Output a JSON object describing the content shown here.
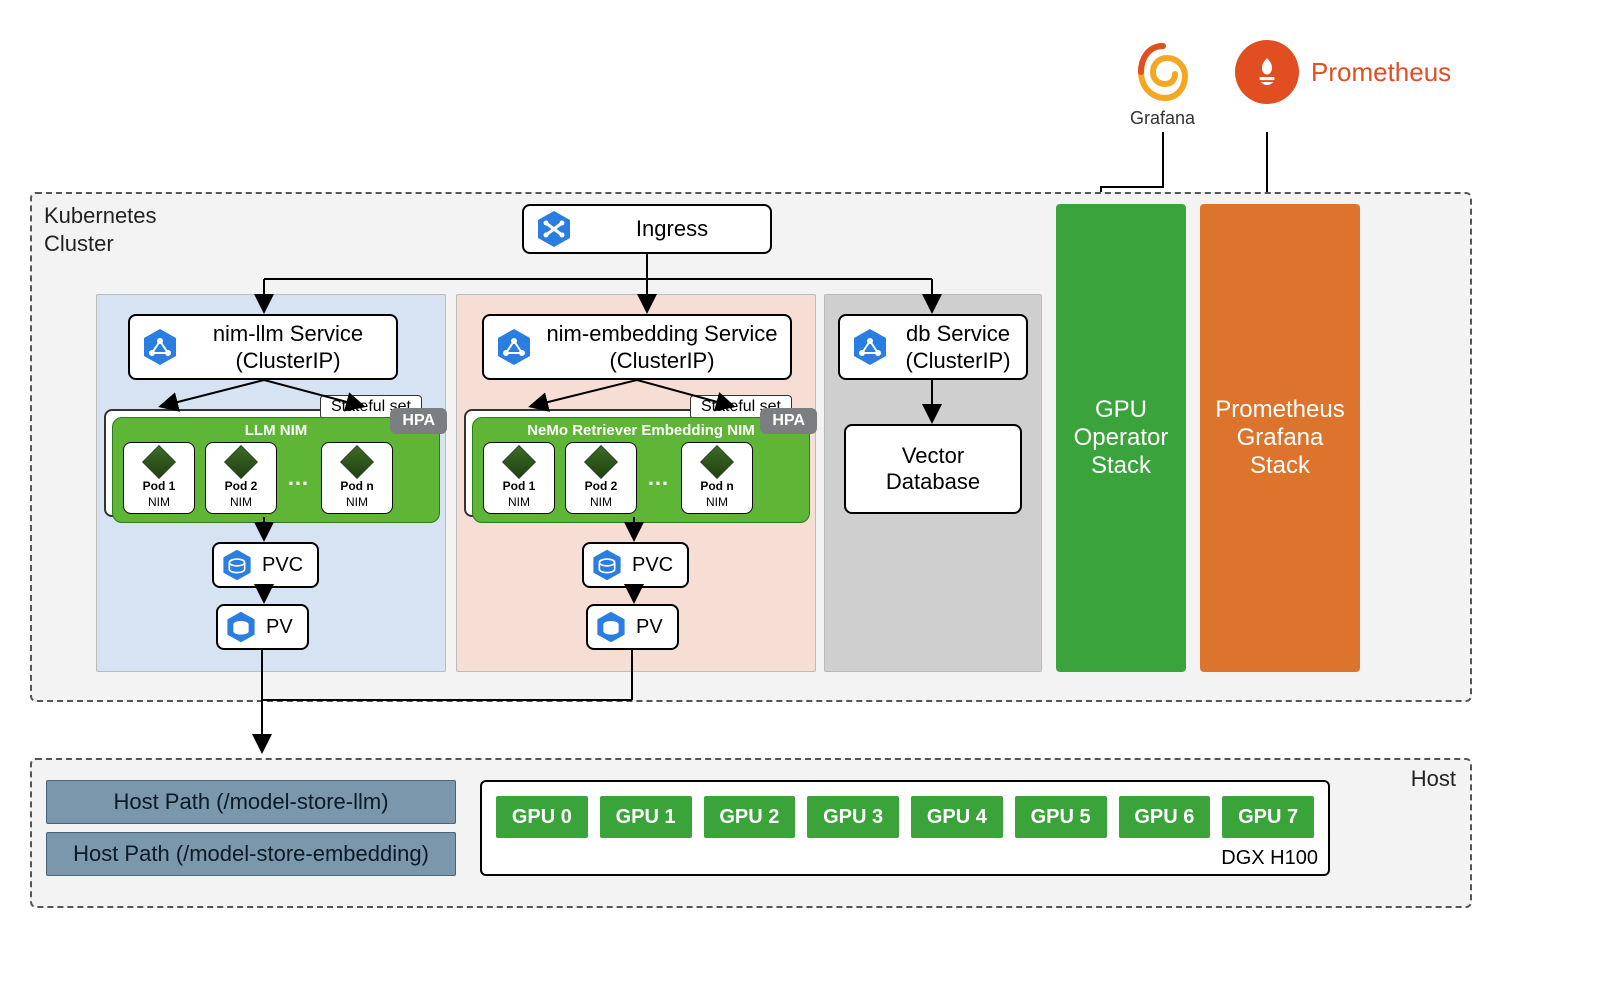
{
  "logos": {
    "grafana_label": "Grafana",
    "prometheus_label": "Prometheus"
  },
  "cluster": {
    "title_l1": "Kubernetes",
    "title_l2": "Cluster",
    "ingress_label": "Ingress",
    "stacks": {
      "gpu_l1": "GPU",
      "gpu_l2": "Operator",
      "gpu_l3": "Stack",
      "pg_l1": "Prometheus",
      "pg_l2": "Grafana",
      "pg_l3": "Stack"
    },
    "services": {
      "llm_l1": "nim-llm Service",
      "llm_l2": "(ClusterIP)",
      "emb_l1": "nim-embedding Service",
      "emb_l2": "(ClusterIP)",
      "db_l1": "db Service",
      "db_l2": "(ClusterIP)",
      "vectordb": "Vector\nDatabase"
    },
    "stateful_set_label": "Stateful set",
    "hpa_label": "HPA",
    "llm_nim_title": "LLM NIM",
    "emb_nim_title": "NeMo Retriever Embedding NIM",
    "pods": {
      "p1": "Pod 1",
      "p2": "Pod 2",
      "pn": "Pod n",
      "nim": "NIM"
    },
    "pvc": "PVC",
    "pv": "PV"
  },
  "host": {
    "title": "Host",
    "dgx_label": "DGX H100",
    "path1": "Host Path (/model-store-llm)",
    "path2": "Host Path (/model-store-embedding)",
    "gpus": [
      "GPU 0",
      "GPU 1",
      "GPU 2",
      "GPU 3",
      "GPU 4",
      "GPU 5",
      "GPU 6",
      "GPU 7"
    ]
  }
}
